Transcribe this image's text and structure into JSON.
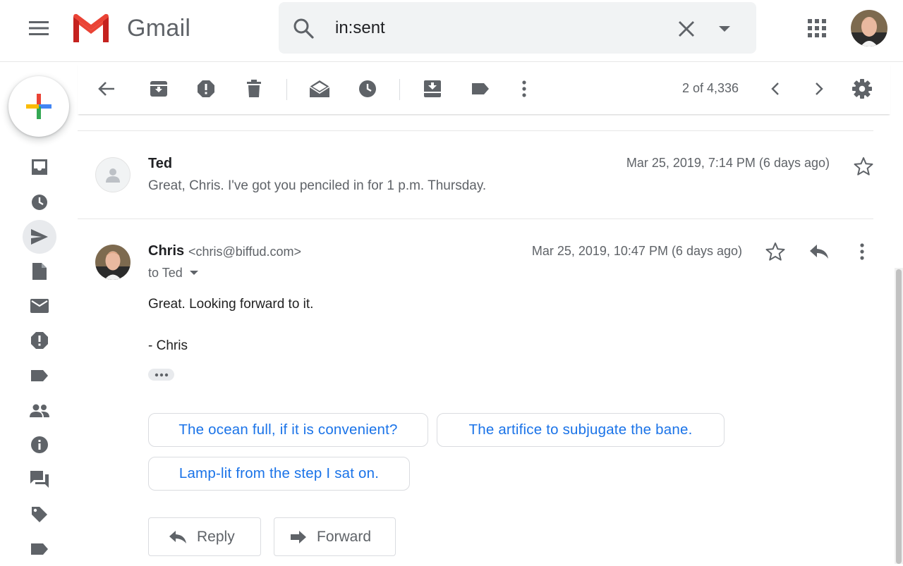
{
  "header": {
    "app_name": "Gmail",
    "search_query": "in:sent"
  },
  "toolbar": {
    "pager": "2 of 4,336"
  },
  "thread": {
    "messages": [
      {
        "sender": "Ted",
        "snippet": "Great, Chris. I've got you penciled in for 1 p.m. Thursday.",
        "date": "Mar 25, 2019, 7:14 PM (6 days ago)"
      },
      {
        "sender": "Chris",
        "email": "<chris@biffud.com>",
        "to": "to Ted",
        "date": "Mar 25, 2019, 10:47 PM (6 days ago)",
        "body": [
          "Great. Looking forward to it.",
          "- Chris"
        ]
      }
    ],
    "smart_replies": [
      "The ocean full, if it is convenient?",
      "The artifice to subjugate the bane.",
      "Lamp-lit from the step I sat on."
    ],
    "actions": {
      "reply": "Reply",
      "forward": "Forward"
    }
  },
  "colors": {
    "link_blue": "#1a73e8",
    "icon_gray": "#5f6368",
    "gmail_red": "#ea4335"
  }
}
